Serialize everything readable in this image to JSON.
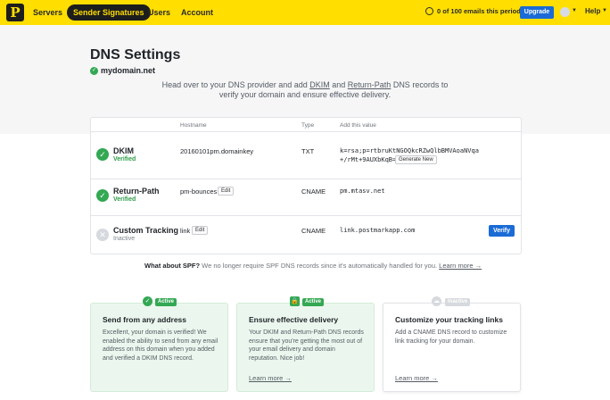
{
  "nav": {
    "logo": "P",
    "items": [
      "Servers",
      "Sender Signatures",
      "Users",
      "Account"
    ],
    "usage_text": "0 of 100 emails this period",
    "upgrade_label": "Upgrade",
    "help_label": "Help"
  },
  "header": {
    "title": "DNS Settings",
    "domain": "mydomain.net",
    "intro_pre": "Head over to your DNS provider and add ",
    "intro_dkim": "DKIM",
    "intro_and": " and ",
    "intro_rp": "Return-Path",
    "intro_post": " DNS records to verify your domain and ensure effective delivery."
  },
  "table": {
    "columns": [
      "Hostname",
      "Type",
      "Add this value"
    ],
    "rows": [
      {
        "name": "DKIM",
        "status": "Verified",
        "hostname": "20160101pm.domainkey",
        "type": "TXT",
        "value_line1": "k=rsa;p=rtbruKtNGOQkcRZwQlbBMVAoaNVqa",
        "value_line2": "+/rMt+9AUXbKqB=",
        "action": "Generate New"
      },
      {
        "name": "Return-Path",
        "status": "Verified",
        "hostname": "pm-bounces",
        "edit": "Edit",
        "type": "CNAME",
        "value_line1": "pm.mtasv.net"
      },
      {
        "name": "Custom Tracking",
        "status": "Inactive",
        "hostname": "link",
        "edit": "Edit",
        "type": "CNAME",
        "value_line1": "link.postmarkapp.com",
        "action": "Verify"
      }
    ]
  },
  "spf": {
    "question": "What about SPF?",
    "text": " We no longer require SPF DNS records since it's automatically handled for you. ",
    "link": "Learn more →"
  },
  "cards": [
    {
      "badge": "Active",
      "title": "Send from any address",
      "desc": "Excellent, your domain is verified! We enabled the ability to send from any email address on this domain when you added and verified a DKIM DNS record.",
      "link": ""
    },
    {
      "badge": "Active",
      "title": "Ensure effective delivery",
      "desc": "Your DKIM and Return-Path DNS records ensure that you're getting the most out of your email delivery and domain reputation. Nice job!",
      "link": "Learn more →"
    },
    {
      "badge": "Inactive",
      "title": "Customize your tracking links",
      "desc": "Add a CNAME DNS record to customize link tracking for your domain.",
      "link": "Learn more →"
    }
  ],
  "colors": {
    "brand_yellow": "#ffde00",
    "primary_blue": "#1a6bd6",
    "success_green": "#34a853"
  },
  "icons": [
    "check-icon",
    "x-icon",
    "lock-icon",
    "cloud-icon",
    "caret-down-icon"
  ]
}
